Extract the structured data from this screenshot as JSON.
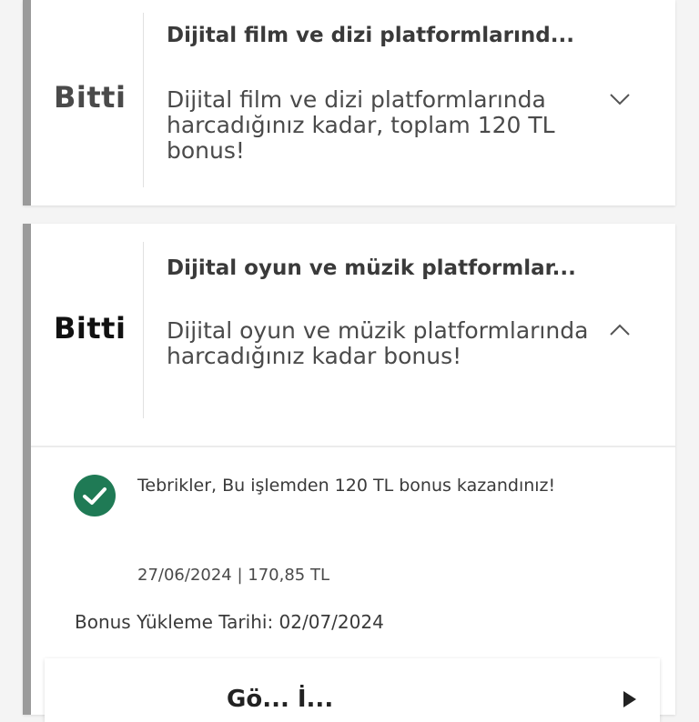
{
  "cards": [
    {
      "status": "Bitti",
      "title": "Dijital film ve dizi platformlarınd...",
      "description": "Dijital film ve dizi platformlarında harcadığınız kadar, toplam 120 TL bonus!",
      "expand_icon": "chevron-down-icon",
      "expanded": false
    },
    {
      "status": "Bitti",
      "title": "Dijital oyun ve müzik platformlar...",
      "description": "Dijital oyun ve müzik platformlarında harcadığınız kadar bonus!",
      "expand_icon": "chevron-up-icon",
      "expanded": true,
      "details": {
        "success_icon": "check-circle-icon",
        "congrats_text": "Tebrikler, Bu işlemden 120 TL bonus kazandınız!",
        "transaction": "27/06/2024 | 170,85  TL",
        "load_date_label": "Bonus Yükleme Tarihi: 02/07/2024",
        "action_label": "Gö... İ...",
        "action_icon": "chevron-right-icon"
      }
    }
  ],
  "colors": {
    "status_bar": "#9a9a9a",
    "success": "#1f7a55"
  }
}
